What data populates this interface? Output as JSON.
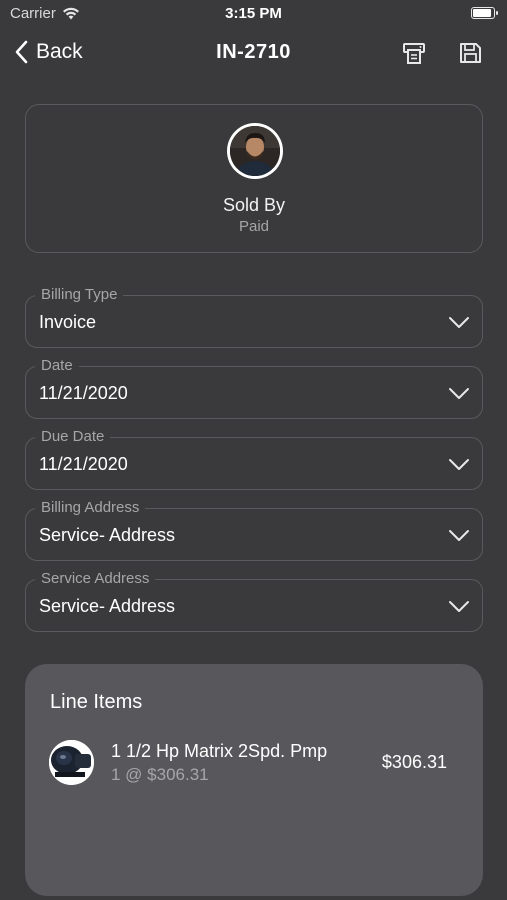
{
  "status_bar": {
    "carrier": "Carrier",
    "time": "3:15 PM",
    "battery_level": 0.95
  },
  "nav": {
    "back_label": "Back",
    "title": "IN-2710",
    "print_icon": "print-icon",
    "save_icon": "save-icon"
  },
  "profile": {
    "name": "Sold By",
    "status": "Paid"
  },
  "fields": [
    {
      "label": "Billing Type",
      "value": "Invoice"
    },
    {
      "label": "Date",
      "value": "11/21/2020"
    },
    {
      "label": "Due Date",
      "value": "11/21/2020"
    },
    {
      "label": "Billing Address",
      "value": "Service- Address"
    },
    {
      "label": "Service Address",
      "value": "Service- Address"
    }
  ],
  "line_items": {
    "title": "Line Items",
    "items": [
      {
        "name": "1 1/2 Hp Matrix 2Spd. Pmp",
        "qty": "1 @ $306.31",
        "total": "$306.31"
      }
    ]
  },
  "colors": {
    "background": "#3a3a3c",
    "card_border": "#5a5a5e",
    "line_items_bg": "#58585c",
    "muted_text": "#a6a6a8"
  }
}
